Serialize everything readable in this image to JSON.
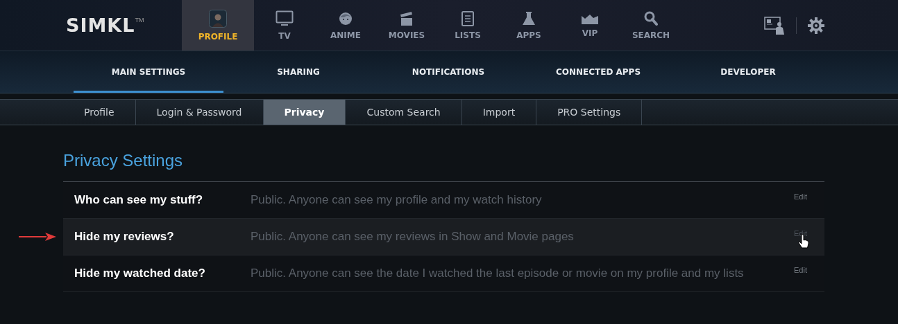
{
  "logo": {
    "text": "SIMKL",
    "mark": "TM"
  },
  "nav": [
    {
      "label": "PROFILE",
      "selected": true
    },
    {
      "label": "TV",
      "selected": false
    },
    {
      "label": "ANIME",
      "selected": false
    },
    {
      "label": "MOVIES",
      "selected": false
    },
    {
      "label": "LISTS",
      "selected": false
    },
    {
      "label": "APPS",
      "selected": false
    },
    {
      "label": "VIP",
      "selected": false
    },
    {
      "label": "SEARCH",
      "selected": false
    }
  ],
  "settings_tabs": [
    {
      "label": "MAIN SETTINGS",
      "selected": true
    },
    {
      "label": "SHARING",
      "selected": false
    },
    {
      "label": "NOTIFICATIONS",
      "selected": false
    },
    {
      "label": "CONNECTED APPS",
      "selected": false
    },
    {
      "label": "DEVELOPER",
      "selected": false
    }
  ],
  "sub_tabs": [
    {
      "label": "Profile",
      "selected": false
    },
    {
      "label": "Login & Password",
      "selected": false
    },
    {
      "label": "Privacy",
      "selected": true
    },
    {
      "label": "Custom Search",
      "selected": false
    },
    {
      "label": "Import",
      "selected": false
    },
    {
      "label": "PRO Settings",
      "selected": false
    }
  ],
  "section_title": "Privacy Settings",
  "settings": [
    {
      "label": "Who can see my stuff?",
      "value": "Public. Anyone can see my profile and my watch history",
      "action": "Edit",
      "hovered": false
    },
    {
      "label": "Hide my reviews?",
      "value": "Public. Anyone can see my reviews in Show and Movie pages",
      "action": "Edit",
      "hovered": true
    },
    {
      "label": "Hide my watched date?",
      "value": "Public. Anyone can see the date I watched the last episode or movie on my profile and my lists",
      "action": "Edit",
      "hovered": false
    }
  ]
}
